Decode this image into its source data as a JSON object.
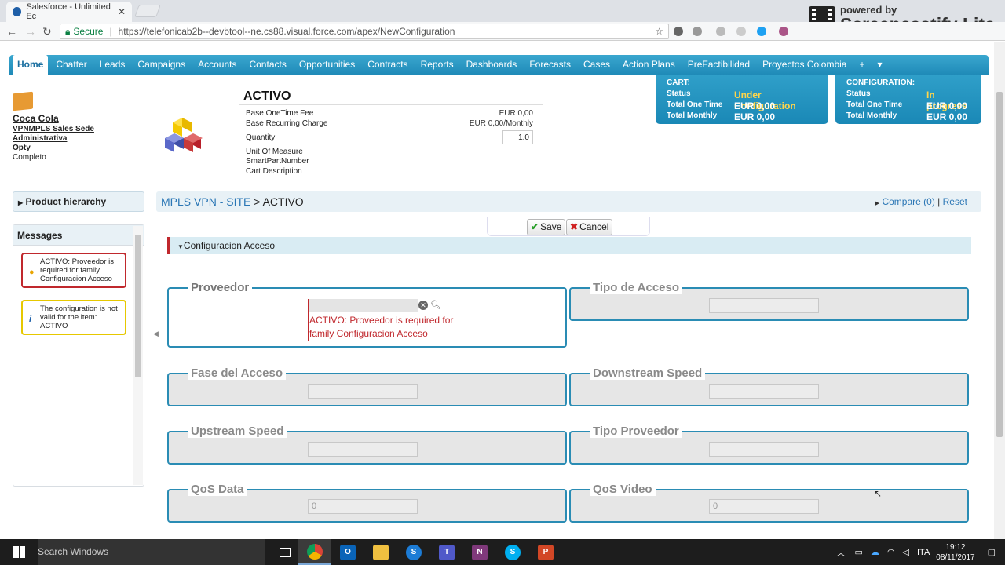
{
  "browser": {
    "tab_title": "Salesforce - Unlimited Ec",
    "tab_close": "✕",
    "secure_label": "Secure",
    "url": "https://telefonicab2b--devbtool--ne.cs88.visual.force.com/apex/NewConfiguration"
  },
  "overlay": {
    "line1": "powered by",
    "line2": "Screencastify Lite"
  },
  "nav": {
    "items": [
      "Home",
      "Chatter",
      "Leads",
      "Campaigns",
      "Accounts",
      "Contacts",
      "Opportunities",
      "Contracts",
      "Reports",
      "Dashboards",
      "Forecasts",
      "Cases",
      "Action Plans",
      "PreFactibilidad",
      "Proyectos Colombia",
      "+",
      "▾"
    ]
  },
  "account": {
    "name": "Coca Cola",
    "opty_line1": "VPNMPLS Sales Sede",
    "opty_line2": "Administrativa",
    "opty_label": "Opty",
    "status": "Completo"
  },
  "product": {
    "title": "ACTIVO",
    "base_onetime_label": "Base OneTime Fee",
    "base_onetime_value": "EUR 0,00",
    "base_recurring_label": "Base Recurring Charge",
    "base_recurring_value": "EUR 0,00/Monthly",
    "quantity_label": "Quantity",
    "quantity_value": "1.0",
    "uom_label": "Unit Of Measure",
    "spn_label": "SmartPartNumber",
    "cart_desc_label": "Cart Description"
  },
  "cart": {
    "heading": "CART:",
    "status_label": "Status",
    "status_value": "Under Configuration",
    "onetime_label": "Total One Time",
    "onetime_value": "EUR 0,00",
    "monthly_label": "Total Monthly",
    "monthly_value": "EUR 0,00"
  },
  "configuration": {
    "heading": "CONFIGURATION:",
    "status_label": "Status",
    "status_value": "In progress",
    "onetime_label": "Total One Time",
    "onetime_value": "EUR 0,00",
    "monthly_label": "Total Monthly",
    "monthly_value": "EUR 0,00"
  },
  "sidebar": {
    "hierarchy_label": "Product hierarchy",
    "messages_label": "Messages",
    "messages": [
      {
        "text": "ACTIVO: Proveedor is required for family Configuracion Acceso",
        "kind": "error"
      },
      {
        "text": "The configuration is not valid for the item: ACTIVO",
        "kind": "info"
      }
    ]
  },
  "breadcrumb": {
    "link": "MPLS VPN - SITE",
    "sep": ">",
    "current": "ACTIVO",
    "compare": "Compare (0)",
    "divider": "|",
    "reset": "Reset"
  },
  "actions": {
    "save": "Save",
    "cancel": "Cancel"
  },
  "section": {
    "title": "Configuracion Acceso"
  },
  "fields": {
    "proveedor": {
      "label": "Proveedor",
      "error": "ACTIVO: Proveedor is required for family Configuracion Acceso"
    },
    "tipo_acceso": {
      "label": "Tipo de Acceso",
      "value": ""
    },
    "fase_acceso": {
      "label": "Fase del Acceso",
      "value": ""
    },
    "downstream": {
      "label": "Downstream Speed",
      "value": ""
    },
    "upstream": {
      "label": "Upstream Speed",
      "value": ""
    },
    "tipo_proveedor": {
      "label": "Tipo Proveedor",
      "value": ""
    },
    "qos_data": {
      "label": "QoS Data",
      "value": "0"
    },
    "qos_video": {
      "label": "QoS Video",
      "value": "0"
    }
  },
  "taskbar": {
    "search": "Search Windows",
    "lang": "ITA",
    "time": "19:12",
    "date": "08/11/2017"
  },
  "colors": {
    "nav": "#1f8ab8",
    "accent_link": "#2a76b5",
    "error": "#c0282d",
    "status_yellow": "#ffd54a"
  }
}
